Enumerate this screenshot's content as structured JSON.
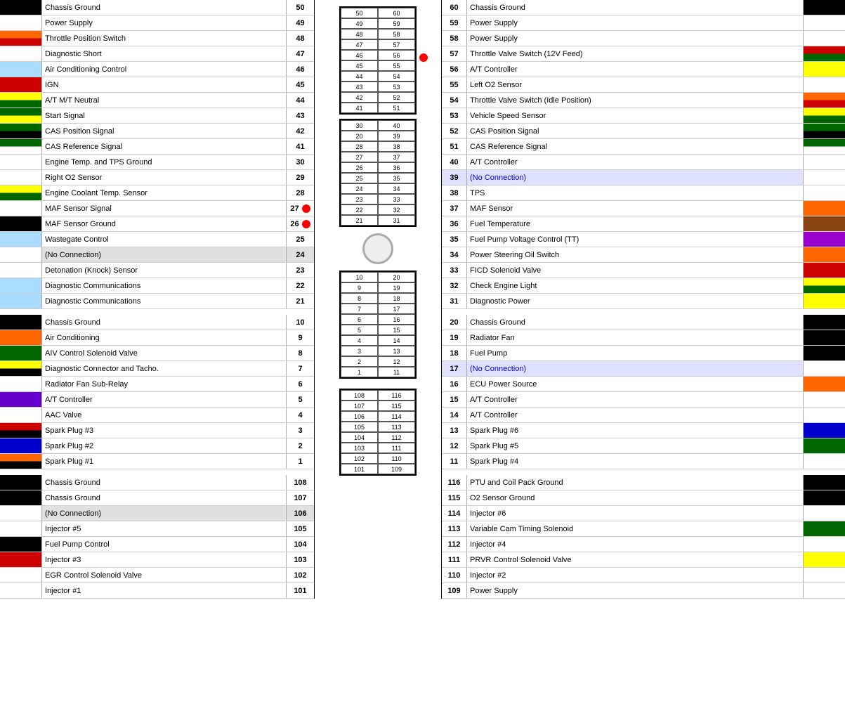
{
  "left_pins": [
    {
      "num": 50,
      "label": "Chassis Ground",
      "color": "#000000",
      "color2": null
    },
    {
      "num": 49,
      "label": "Power Supply",
      "color": "#ffffff",
      "color2": null
    },
    {
      "num": 48,
      "label": "Throttle Position Switch",
      "color": "#ff6600",
      "color2": "#cc0000"
    },
    {
      "num": 47,
      "label": "Diagnostic Short",
      "color": "#ffffff",
      "color2": null
    },
    {
      "num": 46,
      "label": "Air Conditioning Control",
      "color": "#aaddff",
      "color2": null
    },
    {
      "num": 45,
      "label": "IGN",
      "color": "#cc0000",
      "color2": null
    },
    {
      "num": 44,
      "label": "A/T M/T Neutral",
      "color": "#ffff00",
      "color2": "#006600"
    },
    {
      "num": 43,
      "label": "Start Signal",
      "color": "#006600",
      "color2": "#ffff00"
    },
    {
      "num": 42,
      "label": "CAS Position Signal",
      "color": "#006600",
      "color2": "#000000"
    },
    {
      "num": 41,
      "label": "CAS Reference Signal",
      "color": "#006600",
      "color2": "#ffffff"
    },
    {
      "num": 30,
      "label": "Engine Temp. and TPS Ground",
      "color": "#ffffff",
      "color2": null
    },
    {
      "num": 29,
      "label": "Right O2 Sensor",
      "color": "#ffffff",
      "color2": null
    },
    {
      "num": 28,
      "label": "Engine Coolant Temp. Sensor",
      "color": "#ffff00",
      "color2": "#006600"
    },
    {
      "num": 27,
      "label": "MAF Sensor Signal",
      "color": "#ffffff",
      "color2": null,
      "dot": true
    },
    {
      "num": 26,
      "label": "MAF Sensor Ground",
      "color": "#000000",
      "color2": null,
      "dot": true
    },
    {
      "num": 25,
      "label": "Wastegate Control",
      "color": "#aaddff",
      "color2": null
    },
    {
      "num": 24,
      "label": "(No Connection)",
      "color": "#ffffff",
      "color2": null,
      "no_conn": true
    },
    {
      "num": 23,
      "label": "Detonation (Knock) Sensor",
      "color": "#ffffff",
      "color2": null
    },
    {
      "num": 22,
      "label": "Diagnostic Communications",
      "color": "#aaddff",
      "color2": null
    },
    {
      "num": 21,
      "label": "Diagnostic Communications",
      "color": "#aaddff",
      "color2": null
    },
    {
      "num": -1,
      "label": "",
      "color": null,
      "spacer": true
    },
    {
      "num": 10,
      "label": "Chassis Ground",
      "color": "#000000",
      "color2": null
    },
    {
      "num": 9,
      "label": "Air Conditioning",
      "color": "#ff6600",
      "color2": null
    },
    {
      "num": 8,
      "label": "AIV Control Solenoid Valve",
      "color": "#006600",
      "color2": null
    },
    {
      "num": 7,
      "label": "Diagnostic Connector and Tacho.",
      "color": "#ffff00",
      "color2": "#000000"
    },
    {
      "num": 6,
      "label": "Radiator Fan Sub-Relay",
      "color": "#ffffff",
      "color2": null
    },
    {
      "num": 5,
      "label": "A/T Controller",
      "color": "#6600cc",
      "color2": null
    },
    {
      "num": 4,
      "label": "AAC Valve",
      "color": "#ffffff",
      "color2": null
    },
    {
      "num": 3,
      "label": "Spark Plug #3",
      "color": "#cc0000",
      "color2": "#000000"
    },
    {
      "num": 2,
      "label": "Spark Plug #2",
      "color": "#0000cc",
      "color2": null
    },
    {
      "num": 1,
      "label": "Spark Plug #1",
      "color": "#ff6600",
      "color2": "#000000"
    },
    {
      "num": -2,
      "label": "",
      "color": null,
      "spacer": true
    },
    {
      "num": 108,
      "label": "Chassis Ground",
      "color": "#000000",
      "color2": null
    },
    {
      "num": 107,
      "label": "Chassis Ground",
      "color": "#000000",
      "color2": null
    },
    {
      "num": 106,
      "label": "(No Connection)",
      "color": "#ffffff",
      "color2": null,
      "no_conn": true
    },
    {
      "num": 105,
      "label": "Injector #5",
      "color": "#ffffff",
      "color2": null
    },
    {
      "num": 104,
      "label": "Fuel Pump Control",
      "color": "#000000",
      "color2": null
    },
    {
      "num": 103,
      "label": "Injector #3",
      "color": "#cc0000",
      "color2": null
    },
    {
      "num": 102,
      "label": "EGR Control Solenoid Valve",
      "color": "#ffffff",
      "color2": null
    },
    {
      "num": 101,
      "label": "Injector #1",
      "color": "#ffffff",
      "color2": null
    }
  ],
  "right_pins": [
    {
      "num": 60,
      "label": "Chassis Ground",
      "color": "#000000",
      "color2": null
    },
    {
      "num": 59,
      "label": "Power Supply",
      "color": "#ffffff",
      "color2": null
    },
    {
      "num": 58,
      "label": "Power Supply",
      "color": "#ffffff",
      "color2": null
    },
    {
      "num": 57,
      "label": "Throttle Valve Switch (12V Feed)",
      "color": "#cc0000",
      "color2": "#006600"
    },
    {
      "num": 56,
      "label": "A/T Controller",
      "color": "#ffff00",
      "color2": null
    },
    {
      "num": 55,
      "label": "Left O2 Sensor",
      "color": "#ffffff",
      "color2": null
    },
    {
      "num": 54,
      "label": "Throttle Valve Switch (Idle Position)",
      "color": "#ff6600",
      "color2": "#cc0000"
    },
    {
      "num": 53,
      "label": "Vehicle Speed Sensor",
      "color": "#ffff00",
      "color2": "#006600"
    },
    {
      "num": 52,
      "label": "CAS Position Signal",
      "color": "#006600",
      "color2": "#000000"
    },
    {
      "num": 51,
      "label": "CAS Reference Signal",
      "color": "#006600",
      "color2": "#ffffff"
    },
    {
      "num": 40,
      "label": "A/T Controller",
      "color": "#ffffff",
      "color2": null
    },
    {
      "num": 39,
      "label": "(No Connection)",
      "color": "#ffffff",
      "color2": null,
      "no_conn": true
    },
    {
      "num": 38,
      "label": "TPS",
      "color": "#ffffff",
      "color2": null
    },
    {
      "num": 37,
      "label": "MAF Sensor",
      "color": "#ff6600",
      "color2": null
    },
    {
      "num": 36,
      "label": "Fuel Temperature",
      "color": "#8B4513",
      "color2": null
    },
    {
      "num": 35,
      "label": "Fuel Pump Voltage Control (TT)",
      "color": "#9900cc",
      "color2": null
    },
    {
      "num": 34,
      "label": "Power Steering Oil Switch",
      "color": "#ff6600",
      "color2": null
    },
    {
      "num": 33,
      "label": "FICD Solenoid Valve",
      "color": "#cc0000",
      "color2": null
    },
    {
      "num": 32,
      "label": "Check Engine Light",
      "color": "#ffff00",
      "color2": "#006600"
    },
    {
      "num": 31,
      "label": "Diagnostic Power",
      "color": "#ffff00",
      "color2": null
    },
    {
      "num": -1,
      "label": "",
      "color": null,
      "spacer": true
    },
    {
      "num": 20,
      "label": "Chassis Ground",
      "color": "#000000",
      "color2": null
    },
    {
      "num": 19,
      "label": "Radiator Fan",
      "color": "#000000",
      "color2": null
    },
    {
      "num": 18,
      "label": "Fuel Pump",
      "color": "#000000",
      "color2": null
    },
    {
      "num": 17,
      "label": "(No Connection)",
      "color": "#ffffff",
      "color2": null,
      "no_conn": true
    },
    {
      "num": 16,
      "label": "ECU Power Source",
      "color": "#ff6600",
      "color2": null
    },
    {
      "num": 15,
      "label": "A/T Controller",
      "color": "#ffffff",
      "color2": null
    },
    {
      "num": 14,
      "label": "A/T Controller",
      "color": "#ffffff",
      "color2": null
    },
    {
      "num": 13,
      "label": "Spark Plug #6",
      "color": "#0000cc",
      "color2": null
    },
    {
      "num": 12,
      "label": "Spark Plug #5",
      "color": "#006600",
      "color2": null
    },
    {
      "num": 11,
      "label": "Spark Plug #4",
      "color": "#ffffff",
      "color2": null
    },
    {
      "num": -2,
      "label": "",
      "color": null,
      "spacer": true
    },
    {
      "num": 116,
      "label": "PTU and Coil Pack Ground",
      "color": "#000000",
      "color2": null
    },
    {
      "num": 115,
      "label": "O2 Sensor Ground",
      "color": "#000000",
      "color2": null
    },
    {
      "num": 114,
      "label": "Injector #6",
      "color": "#ffffff",
      "color2": null
    },
    {
      "num": 113,
      "label": "Variable Cam Timing Solenoid",
      "color": "#006600",
      "color2": null
    },
    {
      "num": 112,
      "label": "Injector #4",
      "color": "#ffffff",
      "color2": null
    },
    {
      "num": 111,
      "label": "PRVR Control Solenoid Valve",
      "color": "#ffff00",
      "color2": null
    },
    {
      "num": 110,
      "label": "Injector #2",
      "color": "#ffffff",
      "color2": null
    },
    {
      "num": 109,
      "label": "Power Supply",
      "color": "#ffffff",
      "color2": null
    }
  ],
  "middle_groups": [
    {
      "pairs": [
        [
          50,
          60
        ],
        [
          49,
          59
        ],
        [
          48,
          58
        ],
        [
          47,
          57
        ],
        [
          46,
          56
        ],
        [
          45,
          55
        ],
        [
          44,
          54
        ],
        [
          43,
          53
        ],
        [
          42,
          52
        ],
        [
          41,
          51
        ]
      ]
    },
    {
      "pairs": [
        [
          30,
          40
        ],
        [
          20,
          39
        ],
        [
          28,
          38
        ],
        [
          27,
          37
        ],
        [
          26,
          36
        ],
        [
          25,
          35
        ],
        [
          24,
          34
        ],
        [
          23,
          33
        ],
        [
          22,
          32
        ],
        [
          21,
          31
        ]
      ]
    },
    {
      "pairs": [
        [
          10,
          20
        ],
        [
          9,
          19
        ],
        [
          8,
          18
        ],
        [
          7,
          17
        ],
        [
          6,
          16
        ],
        [
          5,
          15
        ],
        [
          4,
          14
        ],
        [
          3,
          13
        ],
        [
          2,
          12
        ],
        [
          1,
          11
        ]
      ]
    },
    {
      "pairs": [
        [
          108,
          116
        ],
        [
          107,
          115
        ],
        [
          106,
          114
        ],
        [
          105,
          113
        ],
        [
          104,
          112
        ],
        [
          103,
          111
        ],
        [
          102,
          110
        ],
        [
          101,
          109
        ]
      ]
    }
  ]
}
